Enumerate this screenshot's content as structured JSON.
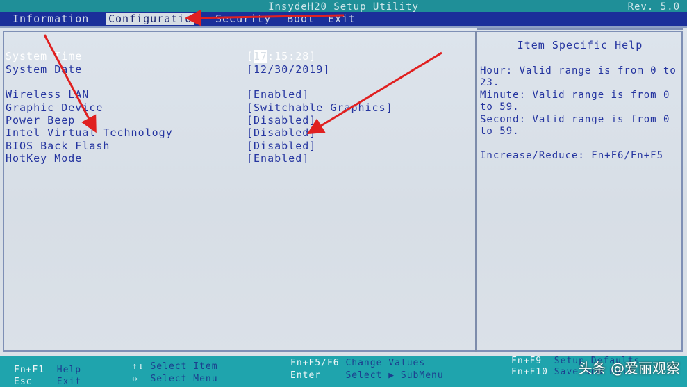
{
  "titlebar": {
    "title": "InsydeH20 Setup Utility",
    "rev": "Rev. 5.0"
  },
  "menu": {
    "tabs": [
      {
        "label": "Information"
      },
      {
        "label": "Configuratio"
      },
      {
        "label": "Security"
      },
      {
        "label": "Boot"
      },
      {
        "label": "Exit"
      }
    ]
  },
  "settings": {
    "rows": [
      {
        "label": "System Time",
        "value_cursor": "17",
        "value_rest": ":15:28]",
        "value_open": "["
      },
      {
        "label": "System Date",
        "value": "[12/30/2019]"
      },
      {
        "label": "Wireless LAN",
        "value": "[Enabled]"
      },
      {
        "label": "Graphic Device",
        "value": "[Switchable Graphics]"
      },
      {
        "label": "Power Beep",
        "value": "[Disabled]"
      },
      {
        "label": "Intel Virtual Technology",
        "value": "[Disabled]"
      },
      {
        "label": "BIOS Back Flash",
        "value": "[Disabled]"
      },
      {
        "label": "HotKey Mode",
        "value": "[Enabled]"
      }
    ]
  },
  "help": {
    "title": "Item Specific Help",
    "lines": [
      "Hour: Valid range is from 0 to",
      "23.",
      "Minute: Valid range is from 0",
      "to 59.",
      "Second: Valid range is from 0",
      "to 59.",
      "",
      "Increase/Reduce: Fn+F6/Fn+F5"
    ]
  },
  "footer": {
    "items": [
      {
        "key": "Fn+F1",
        "action": "Help"
      },
      {
        "key": "Esc",
        "action": "Exit"
      },
      {
        "key": "↑↓",
        "action": "Select Item"
      },
      {
        "key": "↔",
        "action": "Select Menu"
      },
      {
        "key": "Fn+F5/F6",
        "action": "Change Values"
      },
      {
        "key": "Enter",
        "action": "Select ▶ SubMenu"
      },
      {
        "key": "Fn+F9",
        "action": "Setup Defaults"
      },
      {
        "key": "Fn+F10",
        "action": "Save and Exit"
      }
    ]
  },
  "watermark": "头条 @爱丽观察",
  "colors": {
    "annotation_arrow": "#e02020",
    "highlight_text": "#ffffff",
    "menu_active_bg": "#d6dde4"
  }
}
